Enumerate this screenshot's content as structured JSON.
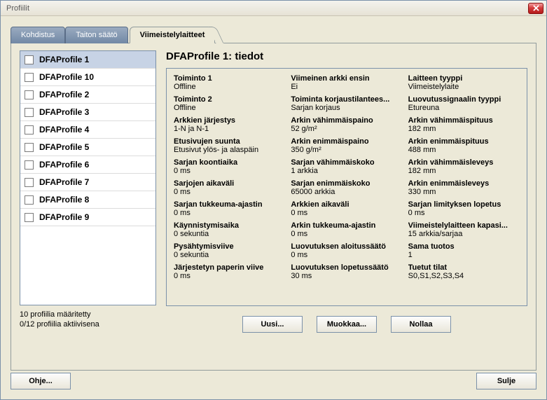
{
  "window": {
    "title": "Profiilit"
  },
  "tabs": [
    {
      "label": "Kohdistus",
      "active": false
    },
    {
      "label": "Taiton säätö",
      "active": false
    },
    {
      "label": "Viimeistelylaitteet",
      "active": true
    }
  ],
  "profiles": [
    {
      "label": "DFAProfile 1",
      "selected": true
    },
    {
      "label": "DFAProfile 10",
      "selected": false
    },
    {
      "label": "DFAProfile 2",
      "selected": false
    },
    {
      "label": "DFAProfile 3",
      "selected": false
    },
    {
      "label": "DFAProfile 4",
      "selected": false
    },
    {
      "label": "DFAProfile 5",
      "selected": false
    },
    {
      "label": "DFAProfile 6",
      "selected": false
    },
    {
      "label": "DFAProfile 7",
      "selected": false
    },
    {
      "label": "DFAProfile 8",
      "selected": false
    },
    {
      "label": "DFAProfile 9",
      "selected": false
    }
  ],
  "list_footer": {
    "line1": "10 profiilia määritetty",
    "line2": "0/12 profiilia aktiivisena"
  },
  "detail_title": "DFAProfile 1: tiedot",
  "details": {
    "col1": [
      {
        "k": "Toiminto 1",
        "v": "Offline"
      },
      {
        "k": "Toiminto 2",
        "v": "Offline"
      },
      {
        "k": "Arkkien järjestys",
        "v": "1-N ja N-1"
      },
      {
        "k": "Etusivujen suunta",
        "v": "Etusivut ylös- ja alaspäin"
      },
      {
        "k": "Sarjan koontiaika",
        "v": "0 ms"
      },
      {
        "k": "Sarjojen aikaväli",
        "v": "0 ms"
      },
      {
        "k": "Sarjan tukkeuma-ajastin",
        "v": "0 ms"
      },
      {
        "k": "Käynnistymisaika",
        "v": "0 sekuntia"
      },
      {
        "k": "Pysähtymisviive",
        "v": "0 sekuntia"
      },
      {
        "k": "Järjestetyn paperin viive",
        "v": "0 ms"
      }
    ],
    "col2": [
      {
        "k": "Viimeinen arkki ensin",
        "v": "Ei"
      },
      {
        "k": "Toiminta korjaustilantees...",
        "v": "Sarjan korjaus"
      },
      {
        "k": "Arkin vähimmäispaino",
        "v": "52 g/m²"
      },
      {
        "k": "Arkin enimmäispaino",
        "v": "350 g/m²"
      },
      {
        "k": "Sarjan vähimmäiskoko",
        "v": "1 arkkia"
      },
      {
        "k": "Sarjan enimmäiskoko",
        "v": "65000 arkkia"
      },
      {
        "k": "Arkkien aikaväli",
        "v": "0 ms"
      },
      {
        "k": "Arkin tukkeuma-ajastin",
        "v": "0 ms"
      },
      {
        "k": "Luovutuksen aloitussäätö",
        "v": "0 ms"
      },
      {
        "k": "Luovutuksen lopetussäätö",
        "v": "30 ms"
      }
    ],
    "col3": [
      {
        "k": "Laitteen tyyppi",
        "v": "Viimeistelylaite"
      },
      {
        "k": "Luovutussignaalin tyyppi",
        "v": "Etureuna"
      },
      {
        "k": "Arkin vähimmäispituus",
        "v": "182 mm"
      },
      {
        "k": "Arkin enimmäispituus",
        "v": "488 mm"
      },
      {
        "k": "Arkin vähimmäisleveys",
        "v": "182 mm"
      },
      {
        "k": "Arkin enimmäisleveys",
        "v": "330 mm"
      },
      {
        "k": "Sarjan limityksen lopetus",
        "v": "0 ms"
      },
      {
        "k": "Viimeistelylaitteen kapasi...",
        "v": "15 arkkia/sarjaa"
      },
      {
        "k": "Sama tuotos",
        "v": "1"
      },
      {
        "k": "Tuetut tilat",
        "v": "S0,S1,S2,S3,S4"
      }
    ]
  },
  "buttons": {
    "new": "Uusi...",
    "edit": "Muokkaa...",
    "reset": "Nollaa",
    "help": "Ohje...",
    "close": "Sulje"
  }
}
